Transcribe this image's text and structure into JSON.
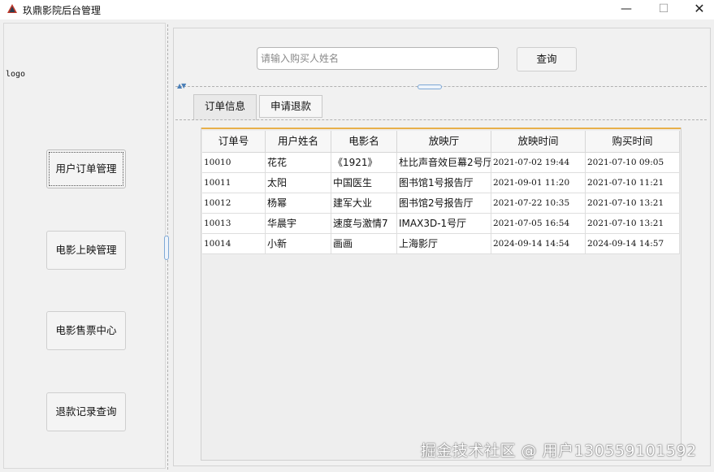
{
  "window": {
    "title": "玖鼎影院后台管理",
    "minimize": "—",
    "maximize": "☐",
    "close": "✕"
  },
  "sidebar": {
    "logo": "logo",
    "items": [
      {
        "label": "用户订单管理"
      },
      {
        "label": "电影上映管理"
      },
      {
        "label": "电影售票中心"
      },
      {
        "label": "退款记录查询"
      }
    ]
  },
  "search": {
    "placeholder": "请输入购买人姓名",
    "value": "",
    "button_label": "查询"
  },
  "tabs": [
    {
      "label": "订单信息"
    },
    {
      "label": "申请退款"
    }
  ],
  "table": {
    "headers": [
      "订单号",
      "用户姓名",
      "电影名",
      "放映厅",
      "放映时间",
      "购买时间"
    ],
    "rows": [
      [
        "10010",
        "花花",
        "《1921》",
        "杜比声音效巨幕2号厅",
        "2021-07-02 19:44",
        "2021-07-10 09:05"
      ],
      [
        "10011",
        "太阳",
        "中国医生",
        "图书馆1号报告厅",
        "2021-09-01 11:20",
        "2021-07-10 11:21"
      ],
      [
        "10012",
        "杨幂",
        "建军大业",
        "图书馆2号报告厅",
        "2021-07-22 10:35",
        "2021-07-10 13:21"
      ],
      [
        "10013",
        "华晨宇",
        "速度与激情7",
        "IMAX3D-1号厅",
        "2021-07-05 16:54",
        "2021-07-10 13:21"
      ],
      [
        "10014",
        "小新",
        "画画",
        "上海影厅",
        "2024-09-14 14:54",
        "2024-09-14 14:57"
      ]
    ]
  },
  "watermark": "掘金技术社区 @ 用户130559101592",
  "colors": {
    "accent_line": "#e8b04a",
    "splitter_handle": "#7ea8d6"
  }
}
